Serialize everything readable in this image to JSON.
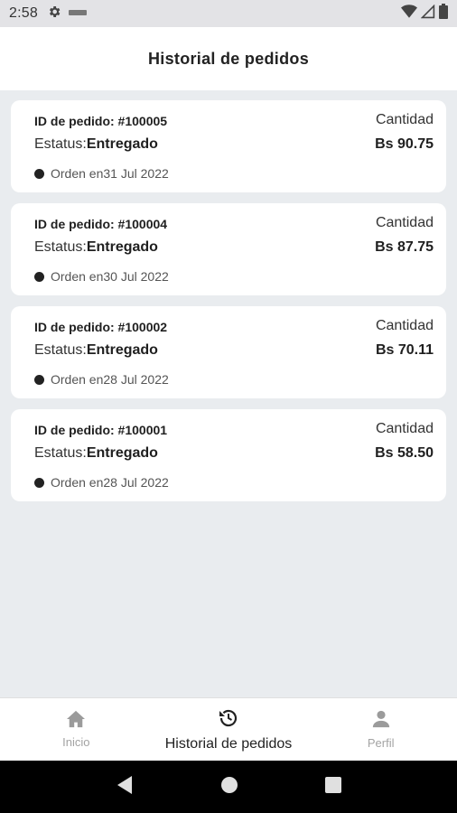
{
  "status_bar": {
    "time": "2:58",
    "icons": [
      "settings-icon",
      "notification-icon",
      "wifi-icon",
      "signal-icon",
      "battery-icon"
    ]
  },
  "app_bar": {
    "title": "Historial de pedidos"
  },
  "orders": [
    {
      "id_text": "ID de pedido: #100005",
      "status_label": "Estatus:",
      "status_value": "Entregado",
      "date_text": "Orden en31 Jul 2022",
      "qty_label": "Cantidad",
      "amount": "Bs 90.75"
    },
    {
      "id_text": "ID de pedido: #100004",
      "status_label": "Estatus:",
      "status_value": "Entregado",
      "date_text": "Orden en30 Jul 2022",
      "qty_label": "Cantidad",
      "amount": "Bs 87.75"
    },
    {
      "id_text": "ID de pedido: #100002",
      "status_label": "Estatus:",
      "status_value": "Entregado",
      "date_text": "Orden en28 Jul 2022",
      "qty_label": "Cantidad",
      "amount": "Bs 70.11"
    },
    {
      "id_text": "ID de pedido: #100001",
      "status_label": "Estatus:",
      "status_value": "Entregado",
      "date_text": "Orden en28 Jul 2022",
      "qty_label": "Cantidad",
      "amount": "Bs 58.50"
    }
  ],
  "bottom_nav": {
    "items": [
      {
        "label": "Inicio",
        "icon": "home-icon",
        "active": false
      },
      {
        "label": "Historial de pedidos",
        "icon": "history-icon",
        "active": true
      },
      {
        "label": "Perfil",
        "icon": "person-icon",
        "active": false
      }
    ]
  },
  "system_nav": {
    "icons": [
      "back-icon",
      "home-circle-icon",
      "recents-icon"
    ]
  },
  "colors": {
    "background": "#e9ecef",
    "card": "#ffffff",
    "text": "#1f1f1f",
    "nav_inactive": "#a3a3a3"
  }
}
